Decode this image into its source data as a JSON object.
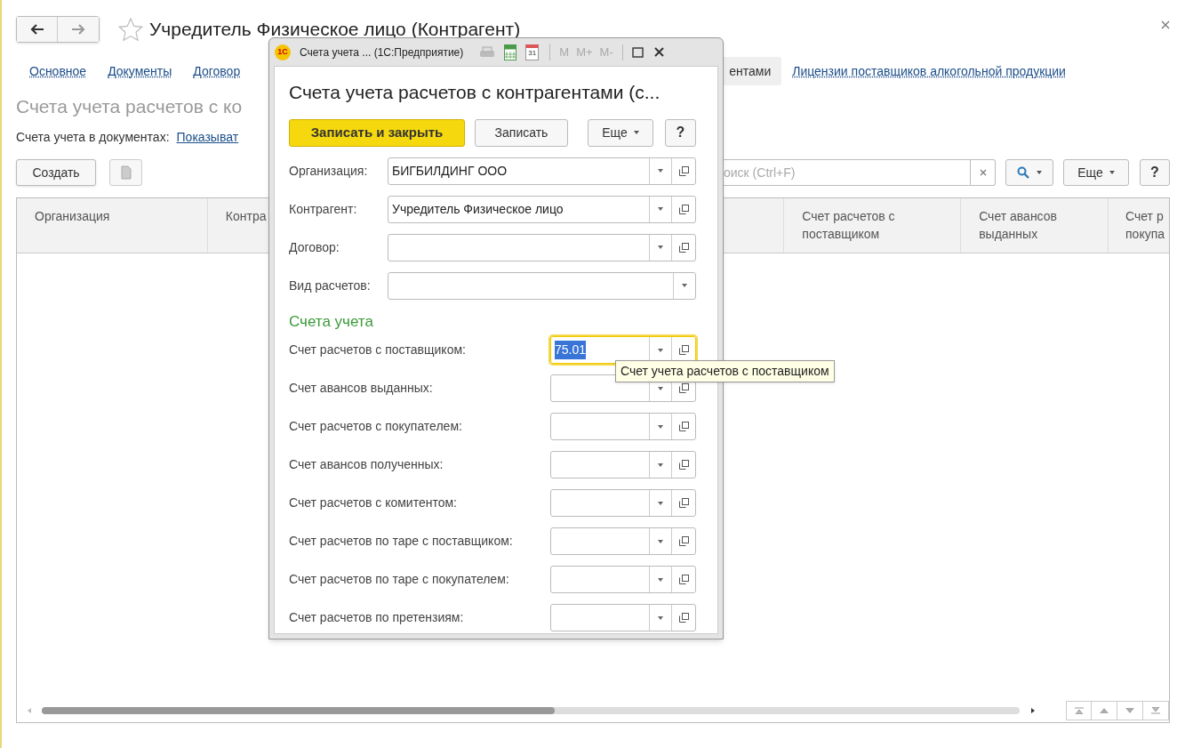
{
  "window": {
    "title": "Учредитель Физическое лицо (Контрагент)"
  },
  "tabs": [
    {
      "label": "Основное",
      "selected": false
    },
    {
      "label": "Документы",
      "selected": false
    },
    {
      "label": "Договор",
      "selected": false
    },
    {
      "label": "ентами",
      "selected": true
    },
    {
      "label": "Лицензии поставщиков алкогольной продукции",
      "selected": false
    }
  ],
  "section_title": "Счета учета расчетов с ко",
  "documents_setting": {
    "label": "Счета учета в документах:",
    "link": "Показыват"
  },
  "toolbar": {
    "create": "Создать",
    "search": {
      "placeholder": "оиск (Ctrl+F)"
    },
    "more": "Еще",
    "help": "?"
  },
  "table": {
    "columns": [
      {
        "label": "Организация"
      },
      {
        "label": "Контра"
      },
      {},
      {
        "label": "Счет расчетов с поставщиком"
      },
      {
        "label": "Счет авансов выданных"
      },
      {
        "label": "Счет р покупа"
      }
    ]
  },
  "dialog": {
    "logo": "1С",
    "title": "Счета учета ... (1С:Предприятие)",
    "calendar_day": "31",
    "memory_buttons": [
      "M",
      "M+",
      "M-"
    ],
    "heading": "Счета учета расчетов с контрагентами (с...",
    "buttons": {
      "save_close": "Записать и закрыть",
      "save": "Записать",
      "more": "Еще",
      "help": "?"
    },
    "fields": [
      {
        "label": "Организация:",
        "value": "БИГБИЛДИНГ ООО",
        "kind": "choice"
      },
      {
        "label": "Контрагент:",
        "value": "Учредитель Физическое лицо",
        "kind": "choice"
      },
      {
        "label": "Договор:",
        "kind": "choice"
      },
      {
        "label": "Вид расчетов:",
        "kind": "dropdown"
      }
    ],
    "section": "Счета учета",
    "accounts": [
      {
        "label": "Счет расчетов с поставщиком:",
        "value": "75.01",
        "focused": true
      },
      {
        "label": "Счет авансов выданных:",
        "focused": false
      },
      {
        "label": "Счет расчетов с покупателем:",
        "focused": false
      },
      {
        "label": "Счет авансов полученных:",
        "focused": false
      },
      {
        "label": "Счет расчетов с комитентом:",
        "focused": false
      },
      {
        "label": "Счет расчетов по таре с поставщиком:",
        "focused": false
      },
      {
        "label": "Счет расчетов по таре с покупателем:",
        "focused": false
      },
      {
        "label": "Счет расчетов по претензиям:",
        "focused": false
      }
    ],
    "tooltip": "Счет учета расчетов с поставщиком"
  }
}
